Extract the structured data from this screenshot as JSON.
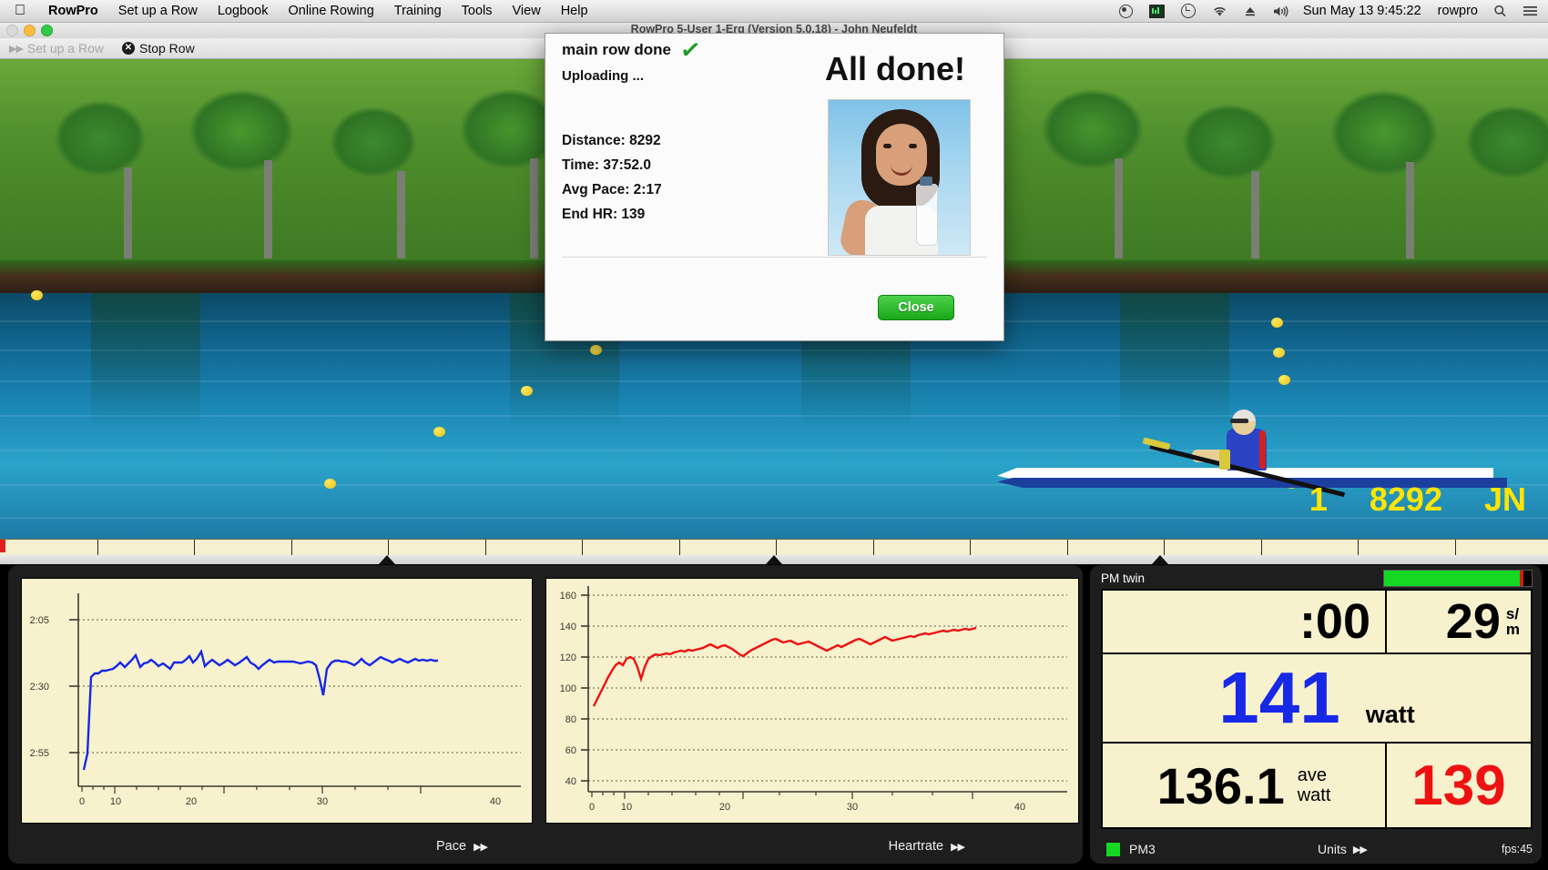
{
  "menubar": {
    "apple_icon": "apple-icon",
    "items": [
      {
        "label": "RowPro",
        "bold": true
      },
      {
        "label": "Set up a Row",
        "bold": false
      },
      {
        "label": "Logbook",
        "bold": false
      },
      {
        "label": "Online Rowing",
        "bold": false
      },
      {
        "label": "Training",
        "bold": false
      },
      {
        "label": "Tools",
        "bold": false
      },
      {
        "label": "View",
        "bold": false
      },
      {
        "label": "Help",
        "bold": false
      }
    ],
    "status_icons": [
      "record-icon",
      "display-icon",
      "time-machine-icon",
      "wifi-icon",
      "eject-icon",
      "volume-icon"
    ],
    "clock": "Sun May 13  9:45:22",
    "user": "rowpro",
    "search_icon": "search-icon",
    "list_icon": "control-center-icon"
  },
  "window": {
    "title": "RowPro 5-User 1-Erg (Version 5.0.18) - John Neufeldt"
  },
  "toolbar": {
    "setup_label": "Set up a Row",
    "setup_icon": "fast-forward-icon",
    "stop_label": "Stop Row",
    "stop_icon": "stop-x-icon"
  },
  "hud": {
    "lane": "1",
    "distance": "8292",
    "initials": "JN"
  },
  "dialog": {
    "title": "main row done",
    "check_icon": "check-icon",
    "status": "Uploading ...",
    "headline": "All done!",
    "stats": [
      "Distance: 8292",
      "Time: 37:52.0",
      "Avg Pace: 2:17",
      "End HR: 139"
    ],
    "close_label": "Close",
    "photo_alt": "celebration-photo"
  },
  "charts_panel": {
    "pace_label": "Pace",
    "pace_icon": "fast-forward-icon",
    "heartrate_label": "Heartrate",
    "heartrate_icon": "fast-forward-icon"
  },
  "pm": {
    "header_label": "PM twin",
    "progress_percent": 92,
    "split_time": ":00",
    "stroke_rate": "29",
    "stroke_rate_unit_top": "s/",
    "stroke_rate_unit_bottom": "m",
    "watts": "141",
    "watts_unit": "watt",
    "avg_watts": "136.1",
    "avg_label_top": "ave",
    "avg_label_bottom": "watt",
    "heartrate": "139",
    "status_device": "PM3",
    "units_label": "Units",
    "units_icon": "fast-forward-icon",
    "fps": "fps:45",
    "colors": {
      "watts": "#1728e6",
      "heartrate": "#ee1111",
      "progress": "#14d822",
      "lcd_bg": "#f7f1ce"
    }
  },
  "chart_data": [
    {
      "type": "line",
      "title": "Pace",
      "xlabel": "",
      "ylabel": "Pace",
      "x": [
        0,
        1,
        2,
        3,
        4,
        5,
        6,
        7,
        8,
        9,
        10,
        11,
        12,
        13,
        14,
        15,
        16,
        17,
        18,
        19,
        20,
        21,
        22,
        23,
        24,
        25,
        26,
        27,
        28,
        29,
        30,
        31,
        32,
        33,
        34,
        35,
        36,
        37
      ],
      "values": [
        172,
        166,
        138,
        137,
        137,
        136,
        136,
        136,
        135,
        134,
        133,
        134,
        133,
        132,
        130,
        134,
        133,
        133,
        132,
        133,
        134,
        133,
        134,
        135,
        133,
        133,
        133,
        132,
        131,
        133,
        132,
        146,
        133,
        132,
        131,
        131,
        131,
        131
      ],
      "ytick_labels": [
        "2:05",
        "2:30",
        "2:55"
      ],
      "ytick_values": [
        125,
        150,
        175
      ],
      "xtick_labels": [
        "0",
        "10",
        "20",
        "30",
        "40"
      ],
      "xtick_values": [
        0,
        10,
        20,
        30,
        40
      ],
      "xlim": [
        0,
        42
      ],
      "ylim_inverted": [
        120,
        180
      ],
      "grid": true,
      "color": "#1728e6",
      "legend": "none",
      "note": "y axis is pace in seconds-per-500m, smaller (faster) at top"
    },
    {
      "type": "line",
      "title": "Heartrate",
      "xlabel": "",
      "ylabel": "Heartrate",
      "x": [
        0,
        1,
        2,
        3,
        4,
        5,
        6,
        7,
        8,
        9,
        10,
        11,
        12,
        13,
        14,
        15,
        16,
        17,
        18,
        19,
        20,
        21,
        22,
        23,
        24,
        25,
        26,
        27,
        28,
        29,
        30,
        31,
        32,
        33,
        34,
        35,
        36,
        37
      ],
      "values": [
        90,
        96,
        104,
        112,
        120,
        121,
        119,
        110,
        122,
        124,
        123,
        124,
        125,
        126,
        126,
        127,
        128,
        129,
        130,
        129,
        128,
        124,
        127,
        130,
        132,
        133,
        131,
        134,
        133,
        132,
        131,
        127,
        130,
        133,
        135,
        136,
        137,
        139
      ],
      "ytick_labels": [
        "40",
        "60",
        "80",
        "100",
        "120",
        "140",
        "160"
      ],
      "ytick_values": [
        40,
        60,
        80,
        100,
        120,
        140,
        160
      ],
      "xtick_labels": [
        "0",
        "10",
        "20",
        "30",
        "40"
      ],
      "xtick_values": [
        0,
        10,
        20,
        30,
        40
      ],
      "xlim": [
        0,
        42
      ],
      "ylim": [
        30,
        170
      ],
      "grid": true,
      "color": "#ee1111",
      "legend": "none"
    }
  ]
}
